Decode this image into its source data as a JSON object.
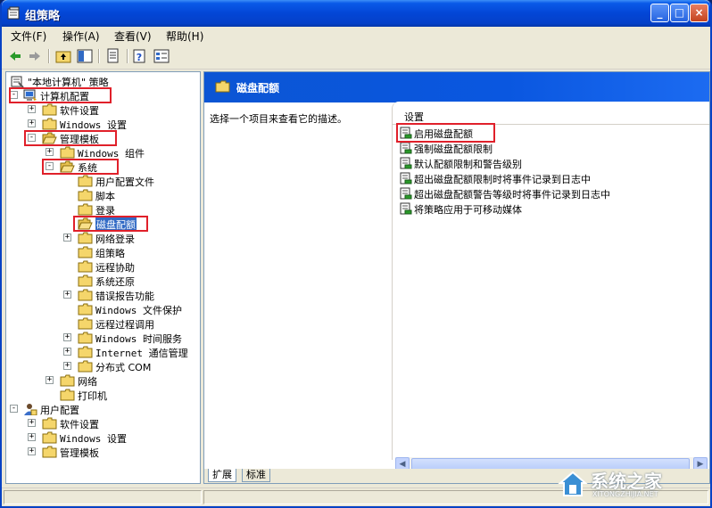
{
  "window": {
    "title": "组策略"
  },
  "menubar": {
    "items": [
      "文件(F)",
      "操作(A)",
      "查看(V)",
      "帮助(H)"
    ]
  },
  "tree": {
    "nodes": [
      {
        "label": "\"本地计算机\" 策略",
        "level": 0,
        "expander": "",
        "icon": "policy-icon"
      },
      {
        "label": "计算机配置",
        "level": 0,
        "expander": "−",
        "icon": "computer-icon"
      },
      {
        "label": "软件设置",
        "level": 1,
        "expander": "+",
        "icon": "folder-icon"
      },
      {
        "label": "Windows 设置",
        "level": 1,
        "expander": "+",
        "icon": "folder-icon"
      },
      {
        "label": "管理模板",
        "level": 1,
        "expander": "−",
        "icon": "folder-open-icon"
      },
      {
        "label": "Windows 组件",
        "level": 2,
        "expander": "+",
        "icon": "folder-icon"
      },
      {
        "label": "系统",
        "level": 2,
        "expander": "−",
        "icon": "folder-open-icon"
      },
      {
        "label": "用户配置文件",
        "level": 3,
        "expander": "",
        "icon": "folder-icon"
      },
      {
        "label": "脚本",
        "level": 3,
        "expander": "",
        "icon": "folder-icon"
      },
      {
        "label": "登录",
        "level": 3,
        "expander": "",
        "icon": "folder-icon"
      },
      {
        "label": "磁盘配额",
        "level": 3,
        "expander": "",
        "icon": "folder-open-icon",
        "selected": true
      },
      {
        "label": "网络登录",
        "level": 3,
        "expander": "+",
        "icon": "folder-icon"
      },
      {
        "label": "组策略",
        "level": 3,
        "expander": "",
        "icon": "folder-icon"
      },
      {
        "label": "远程协助",
        "level": 3,
        "expander": "",
        "icon": "folder-icon"
      },
      {
        "label": "系统还原",
        "level": 3,
        "expander": "",
        "icon": "folder-icon"
      },
      {
        "label": "错误报告功能",
        "level": 3,
        "expander": "+",
        "icon": "folder-icon"
      },
      {
        "label": "Windows 文件保护",
        "level": 3,
        "expander": "",
        "icon": "folder-icon"
      },
      {
        "label": "远程过程调用",
        "level": 3,
        "expander": "",
        "icon": "folder-icon"
      },
      {
        "label": "Windows 时间服务",
        "level": 3,
        "expander": "+",
        "icon": "folder-icon"
      },
      {
        "label": "Internet 通信管理",
        "level": 3,
        "expander": "+",
        "icon": "folder-icon"
      },
      {
        "label": "分布式 COM",
        "level": 3,
        "expander": "+",
        "icon": "folder-icon"
      },
      {
        "label": "网络",
        "level": 2,
        "expander": "+",
        "icon": "folder-icon"
      },
      {
        "label": "打印机",
        "level": 2,
        "expander": "",
        "icon": "folder-icon"
      },
      {
        "label": "用户配置",
        "level": 0,
        "expander": "−",
        "icon": "user-icon"
      },
      {
        "label": "软件设置",
        "level": 1,
        "expander": "+",
        "icon": "folder-icon"
      },
      {
        "label": "Windows 设置",
        "level": 1,
        "expander": "+",
        "icon": "folder-icon"
      },
      {
        "label": "管理模板",
        "level": 1,
        "expander": "+",
        "icon": "folder-icon"
      }
    ]
  },
  "details": {
    "header_title": "磁盘配额",
    "description": "选择一个项目来查看它的描述。",
    "column_header": "设置",
    "items": [
      "启用磁盘配额",
      "强制磁盘配额限制",
      "默认配额限制和警告级别",
      "超出磁盘配额限制时将事件记录到日志中",
      "超出磁盘配额警告等级时将事件记录到日志中",
      "将策略应用于可移动媒体"
    ],
    "tabs": [
      "扩展",
      "标准"
    ]
  },
  "watermark": {
    "text": "系统之家",
    "sub": "XITONGZHIJIA.NET"
  },
  "colors": {
    "title_blue": "#0346d6",
    "selection": "#316ac5",
    "highlight_red": "#e0202a"
  }
}
